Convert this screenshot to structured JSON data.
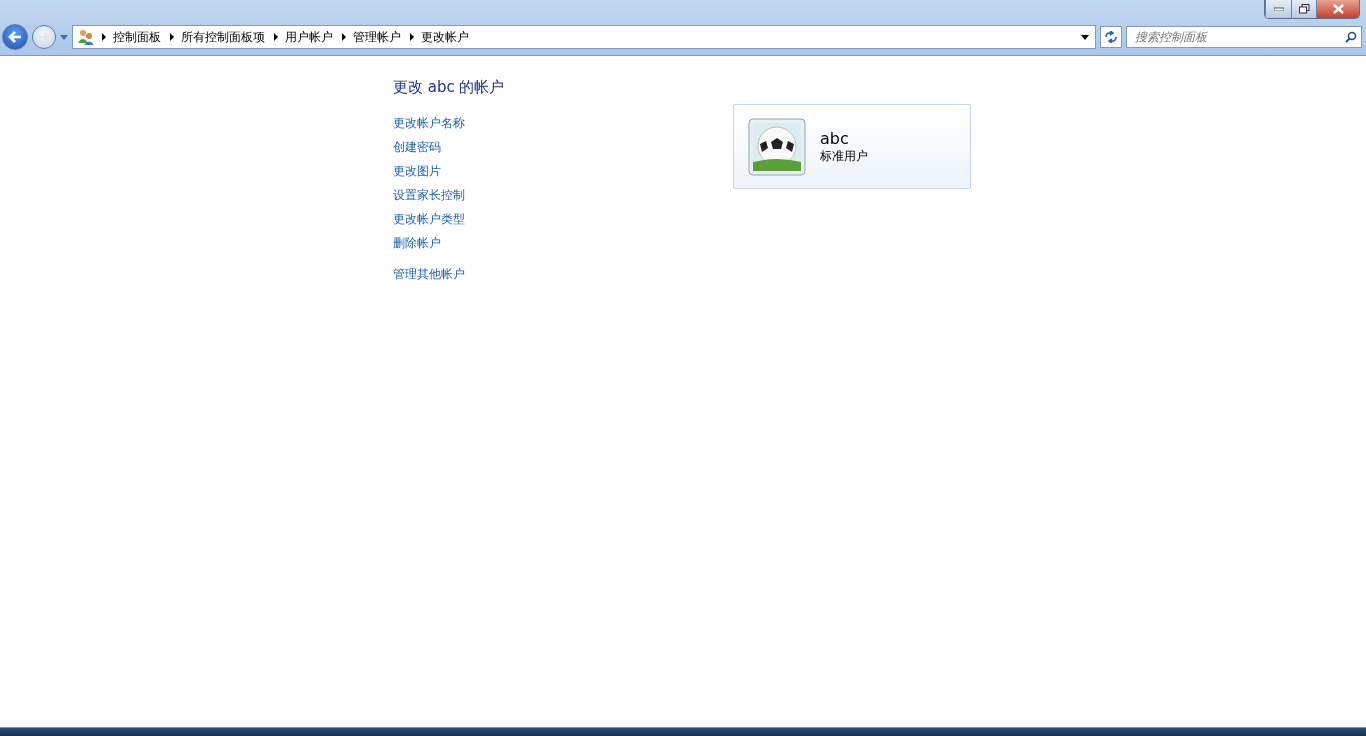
{
  "breadcrumb": [
    "控制面板",
    "所有控制面板项",
    "用户帐户",
    "管理帐户",
    "更改帐户"
  ],
  "search": {
    "placeholder": "搜索控制面板"
  },
  "heading": "更改 abc 的帐户",
  "tasks": [
    "更改帐户名称",
    "创建密码",
    "更改图片",
    "设置家长控制",
    "更改帐户类型",
    "删除帐户"
  ],
  "other_tasks": [
    "管理其他帐户"
  ],
  "account": {
    "name": "abc",
    "type": "标准用户"
  }
}
